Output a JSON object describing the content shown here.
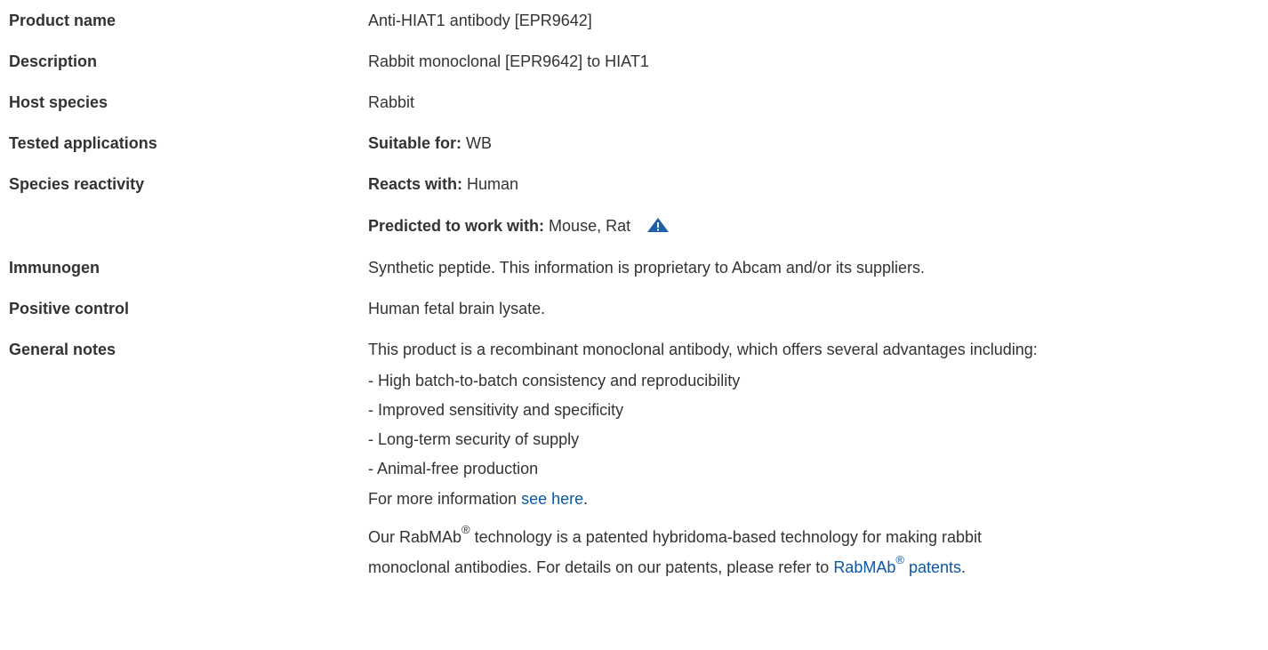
{
  "rows": {
    "product_name": {
      "label": "Product name",
      "value": "Anti-HIAT1 antibody [EPR9642]"
    },
    "description": {
      "label": "Description",
      "value": "Rabbit monoclonal [EPR9642] to HIAT1"
    },
    "host_species": {
      "label": "Host species",
      "value": "Rabbit"
    },
    "tested_applications": {
      "label": "Tested applications",
      "prefix": "Suitable for:",
      "value": "WB"
    },
    "species_reactivity": {
      "label": "Species reactivity",
      "reacts_prefix": "Reacts with:",
      "reacts_value": "Human",
      "predicted_prefix": "Predicted to work with:",
      "predicted_value": "Mouse, Rat",
      "predicted_icon": "warning-triangle-icon"
    },
    "immunogen": {
      "label": "Immunogen",
      "value": "Synthetic peptide. This information is proprietary to Abcam and/or its suppliers."
    },
    "positive_control": {
      "label": "Positive control",
      "value": "Human fetal brain lysate."
    },
    "general_notes": {
      "label": "General notes",
      "intro": "This product is a recombinant monoclonal antibody, which offers several advantages including:",
      "bullets": [
        "- High batch-to-batch consistency and reproducibility",
        "- Improved sensitivity and specificity",
        "- Long-term security of supply",
        "- Animal-free production"
      ],
      "more_info_prefix": "For more information ",
      "more_info_link": "see here",
      "more_info_suffix": ".",
      "rabmab_line1_a": "Our RabMAb",
      "rabmab_reg": "®",
      "rabmab_line1_b": " technology is a patented hybridoma-based technology for making rabbit",
      "rabmab_line2_a": "monoclonal antibodies. For details on our patents, please refer to ",
      "rabmab_link_a": "RabMAb",
      "rabmab_link_reg": "®",
      "rabmab_link_b": " patents",
      "rabmab_line2_suffix": "."
    }
  },
  "colors": {
    "text": "#333333",
    "link": "#0b57a8",
    "icon": "#1f5fa6"
  }
}
